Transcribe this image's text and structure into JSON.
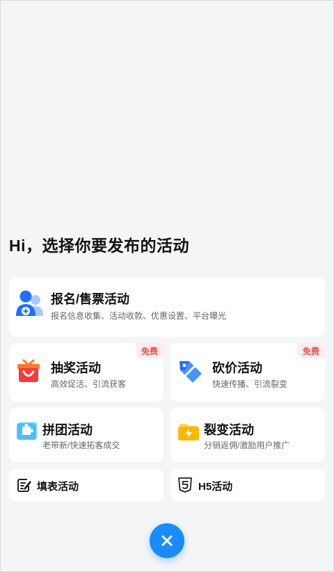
{
  "headline": "Hi，选择你要发布的活动",
  "cards": {
    "signup": {
      "title": "报名/售票活动",
      "subtitle": "报名信息收集、活动收款、优惠设置、平台曝光",
      "icon": "user-plus-icon"
    },
    "lottery": {
      "title": "抽奖活动",
      "subtitle": "高效促活、引流获客",
      "badge": "免费",
      "icon": "gift-box-icon"
    },
    "bargain": {
      "title": "砍价活动",
      "subtitle": "快速传播、引流裂变",
      "badge": "免费",
      "icon": "price-tag-icon"
    },
    "group": {
      "title": "拼团活动",
      "subtitle": "老带新/快速拓客成交",
      "icon": "puzzle-icon"
    },
    "fission": {
      "title": "裂变活动",
      "subtitle": "分销返佣/激励用户推广",
      "icon": "folder-bolt-icon"
    },
    "form": {
      "title": "填表活动",
      "icon": "form-edit-icon"
    },
    "h5": {
      "title": "H5活动",
      "icon": "html5-icon"
    }
  },
  "close_button": {
    "icon": "close-icon"
  },
  "colors": {
    "accent": "#1a8cff",
    "badge_text": "#f04b4b",
    "badge_bg": "#ffeceb",
    "background": "#f4f5f7"
  }
}
